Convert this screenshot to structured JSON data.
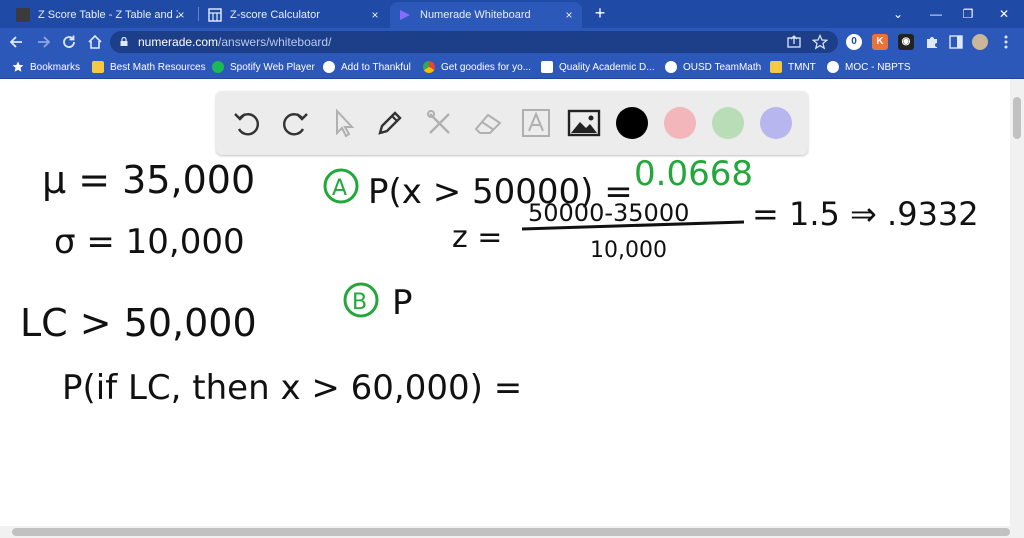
{
  "tabs": [
    {
      "title": "Z Score Table - Z Table and Z score",
      "favicon": "z-table-favicon",
      "active": false
    },
    {
      "title": "Z-score Calculator",
      "favicon": "calculator-icon",
      "active": false
    },
    {
      "title": "Numerade Whiteboard",
      "favicon": "numerade-icon",
      "active": true
    }
  ],
  "tab_close_glyph": "×",
  "new_tab_glyph": "+",
  "window_controls": {
    "minimize": "⌄",
    "collapse": "—",
    "restore": "❐",
    "close": "✕"
  },
  "address_bar": {
    "domain": "numerade.com",
    "path": "/answers/whiteboard/"
  },
  "bookmarks": [
    {
      "label": "Bookmarks",
      "icon": "star-icon"
    },
    {
      "label": "Best Math Resources",
      "icon": "folder-icon"
    },
    {
      "label": "Spotify Web Player",
      "icon": "spotify-icon"
    },
    {
      "label": "Add to Thankful",
      "icon": "globe-icon"
    },
    {
      "label": "Get goodies for yo...",
      "icon": "chrome-icon"
    },
    {
      "label": "Quality Academic D...",
      "icon": "doc-icon"
    },
    {
      "label": "OUSD TeamMath",
      "icon": "globe-icon"
    },
    {
      "label": "TMNT",
      "icon": "folder-icon"
    },
    {
      "label": "MOC - NBPTS",
      "icon": "wordpress-icon"
    }
  ],
  "whiteboard_tools": [
    "undo-icon",
    "redo-icon",
    "pointer-icon",
    "pen-icon",
    "tools-icon",
    "eraser-icon",
    "text-icon",
    "image-icon"
  ],
  "palette_colors": [
    "#000000",
    "#f2b6bb",
    "#b9ddb6",
    "#b8b6ee"
  ],
  "handwriting": {
    "mu_line": "μ = 35,000",
    "sigma_line": "σ = 10,000",
    "lc_line": "LC > 50,000",
    "cond_line": "P(if LC, then x > 60,000) =",
    "part_a_marker": "A",
    "part_a_question": "P(x > 50000) =",
    "part_a_answer": "0.0668",
    "z_label": "z =",
    "z_numerator": "50000-35000",
    "z_denominator": "10,000",
    "z_result": "= 1.5 ⇒ .9332",
    "part_b_marker": "B",
    "part_b_question": "P"
  },
  "colors": {
    "ink": "#111111",
    "green_ink": "#22a83a",
    "tabstrip": "#1f4aa6",
    "toolbar": "#2c58b9"
  }
}
